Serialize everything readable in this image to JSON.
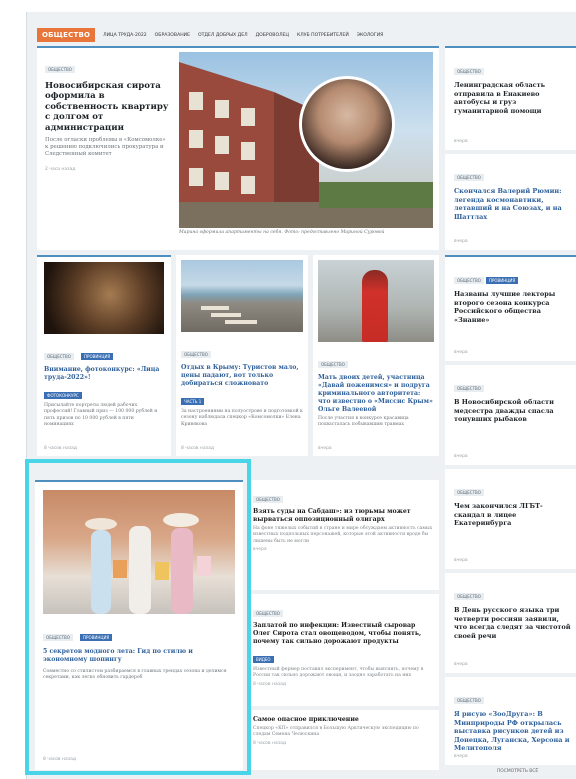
{
  "nav": {
    "badge": "ОБЩЕСТВО",
    "items": [
      "ЛИЦА ТРУДА-2022",
      "ОБРАЗОВАНИЕ",
      "ОТДЕЛ ДОБРЫХ ДЕЛ",
      "ДОБРОВОЛЕЦ",
      "КЛУБ ПОТРЕБИТЕЛЕЙ",
      "ЭКОЛОГИЯ"
    ]
  },
  "lead": {
    "tag": "ОБЩЕСТВО",
    "title": "Новосибирская сирота оформила в собственность квартиру с долгом от администрации",
    "text": "После огласки проблемы в «Комсомолке» к решению подключились прокуратура и Следственный комитет",
    "time": "2 часа назад",
    "caption": "Марина оформила апартаменты на себя. Фото: предоставлено Мариной Суровой"
  },
  "cards_row": [
    {
      "tags": [
        "ОБЩЕСТВО",
        "ПРОВИНЦИЯ"
      ],
      "title": "Внимание, фотоконкурс: «Лица труда-2022»!",
      "badge": "ФОТОКОНКУРС",
      "text": "Присылайте портреты людей рабочих профессий! Главный приз — 100 000 рублей и пять призов по 10 000 рублей в пяти номинациях",
      "time": "8 часов назад"
    },
    {
      "tags": [
        "ОБЩЕСТВО"
      ],
      "title": "Отдых в Крыму: Туристов мало, цены падают, вот только добираться сложновато",
      "badge": "ЧАСТЬ 1",
      "text": "За настроениями на полуострове и подготовкой к сезону наблюдала спецкор «Комсомолки» Елена Кривякова",
      "time": "8 часов назад"
    },
    {
      "tags": [
        "ОБЩЕСТВО"
      ],
      "title": "Мать двоих детей, участница «Давай поженимся» и подруга криминального авторитета: что известно о «Миссис Крым» Ольге Валеевой",
      "text": "После участия в конкурсе красавица похвасталась побывавшим травмах",
      "time": "вчера"
    }
  ],
  "featured": {
    "tags": [
      "ОБЩЕСТВО",
      "ПРОВИНЦИЯ"
    ],
    "title": "5 секретов модного лета: Гид по стилю и экономному шопингу",
    "text": "Совместно со стилистом разбираемся в главных трендах сезона и делимся секретами, как легко обновить гардероб",
    "time": "8 часов назад"
  },
  "newsline": [
    {
      "tag": "ОБЩЕСТВО",
      "title": "Взять суды на Сабдаш»: из тюрьмы может вырваться оппозиционный олигарх",
      "text": "На фоне тяжелых событий в стране и мире обсуждаем активность самых известных подпольных персонажей, которые этой активности вроде бы лишены быть не могли",
      "time": "вчера"
    },
    {
      "tag": "ОБЩЕСТВО",
      "title": "Заплатой по инфекции: Известный сыровар Олег Сирота стал овощеводом, чтобы понять, почему так сильно дорожают продукты",
      "badge": "ВИДЕО",
      "text": "Известный фермер поставил эксперимент, чтобы выяснить, почему в России так сильно дорожают овощи, и заодно заработать на них",
      "time": "8 часов назад"
    },
    {
      "tag": "ОБЩЕСТВО",
      "title": "Самое опасное приключение",
      "text": "Спецкор «КП» отправился в Большую Арктическую экспедицию по следам Семена Челюскина",
      "time": "8 часов назад"
    }
  ],
  "sidebar": [
    {
      "tags": [
        "ОБЩЕСТВО"
      ],
      "title": "Ленинградская область отправила в Енакиево автобусы и груз гуманитарной помощи",
      "link": false,
      "time": "вчера"
    },
    {
      "tags": [
        "ОБЩЕСТВО"
      ],
      "title": "Скончался Валерий Рюмин: легенда космонавтики, летавший и на Союзах, и на Шаттлах",
      "link": true,
      "time": "вчера"
    },
    {
      "tags": [
        "ОБЩЕСТВО",
        "ПРОВИНЦИЯ"
      ],
      "title": "Названы лучшие лекторы второго сезона конкурса Российского общества «Знание»",
      "link": false,
      "time": "вчера"
    },
    {
      "tags": [
        "ОБЩЕСТВО"
      ],
      "title": "В Новосибирской области медсестра дважды спасла тонувших рыбаков",
      "link": false,
      "time": "вчера"
    },
    {
      "tags": [
        "ОБЩЕСТВО"
      ],
      "title": "Чем закончился ЛГБТ-скандал в лицее Екатеринбурга",
      "link": false,
      "time": "вчера"
    },
    {
      "tags": [
        "ОБЩЕСТВО"
      ],
      "title": "В День русского языка три четверти россиян заявили, что всегда следят за чистотой своей речи",
      "link": false,
      "time": "вчера"
    },
    {
      "tags": [
        "ОБЩЕСТВО"
      ],
      "title": "Я рисую «ЗооДруга»: В Минприроды РФ открылась выставка рисунков детей из Донецка, Луганска, Херсона и Мелитополя",
      "link": true,
      "time": "вчера"
    }
  ],
  "footer": {
    "more": "ПОСМОТРЕТЬ ВСЁ"
  },
  "colors": {
    "accent": "#e8763a",
    "link": "#2d5f9a",
    "highlight": "#49d4e8",
    "tag_blue": "#3a6fb3"
  }
}
